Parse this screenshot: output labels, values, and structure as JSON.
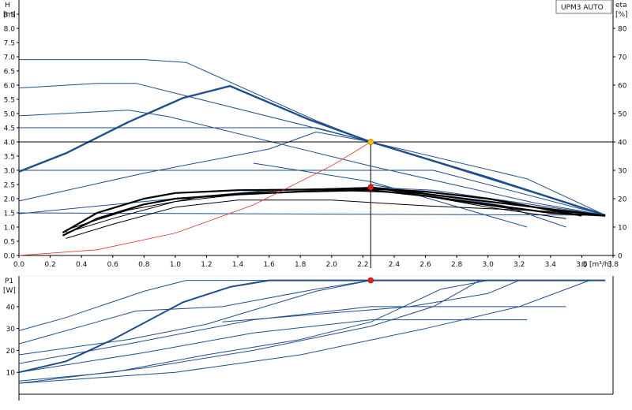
{
  "chart_data": [
    {
      "type": "line",
      "ylabel": "H",
      "ylabel_unit": "[m]",
      "y2label": "eta",
      "y2label_unit": "[%]",
      "xlabel": "Q [m³/h]",
      "model_label": "UPM3 AUTO",
      "xlim": [
        0,
        3.8
      ],
      "ylim": [
        0,
        9.0
      ],
      "y2lim": [
        0,
        90
      ],
      "xticks": [
        0.0,
        0.2,
        0.4,
        0.6,
        0.8,
        1.0,
        1.2,
        1.4,
        1.6,
        1.8,
        2.0,
        2.2,
        2.4,
        2.6,
        2.8,
        3.0,
        3.2,
        3.4,
        3.6,
        3.8
      ],
      "yticks": [
        0.0,
        0.5,
        1.0,
        1.5,
        2.0,
        2.5,
        3.0,
        3.5,
        4.0,
        4.5,
        5.0,
        5.5,
        6.0,
        6.5,
        7.0,
        7.5,
        8.0,
        8.5
      ],
      "y2ticks": [
        0,
        10,
        20,
        30,
        40,
        50,
        60,
        70,
        80
      ],
      "grid": "none",
      "colors": {
        "pump": "#1f4e8c",
        "system": "#e03030",
        "efficiency": "#000000",
        "marker_duty": "#f2c200",
        "marker_eff": "#e02020",
        "crosshair": "#000000"
      },
      "pump_curves": [
        {
          "points": [
            [
              0,
              2.95
            ],
            [
              0.3,
              3.6
            ],
            [
              0.7,
              4.7
            ],
            [
              1.05,
              5.55
            ],
            [
              1.35,
              5.97
            ],
            [
              1.85,
              4.8
            ],
            [
              2.25,
              4.0
            ],
            [
              3.0,
              2.75
            ],
            [
              3.75,
              1.42
            ]
          ],
          "bold": true
        },
        {
          "points": [
            [
              0,
              6.9
            ],
            [
              0.8,
              6.9
            ],
            [
              1.07,
              6.8
            ],
            [
              1.9,
              4.75
            ],
            [
              2.25,
              4.0
            ],
            [
              3.75,
              1.42
            ]
          ],
          "bold": false
        },
        {
          "points": [
            [
              0,
              5.9
            ],
            [
              0.5,
              6.06
            ],
            [
              0.75,
              6.06
            ],
            [
              2.25,
              4.0
            ],
            [
              3.25,
              2.7
            ],
            [
              3.75,
              1.42
            ]
          ],
          "bold": false
        },
        {
          "points": [
            [
              0,
              4.92
            ],
            [
              0.7,
              5.12
            ],
            [
              0.95,
              4.9
            ],
            [
              2.25,
              3.15
            ],
            [
              3.3,
              1.85
            ],
            [
              3.75,
              1.42
            ]
          ],
          "bold": false
        },
        {
          "points": [
            [
              0,
              4.5
            ],
            [
              1.9,
              4.5
            ],
            [
              2.25,
              4.0
            ]
          ],
          "bold": false
        },
        {
          "points": [
            [
              0,
              3.0
            ],
            [
              2.25,
              3.0
            ],
            [
              2.65,
              3.0
            ],
            [
              3.75,
              1.42
            ]
          ],
          "bold": false
        },
        {
          "points": [
            [
              0,
              1.92
            ],
            [
              0.8,
              2.9
            ],
            [
              1.6,
              3.75
            ],
            [
              1.9,
              4.35
            ],
            [
              2.25,
              4.0
            ]
          ],
          "bold": false
        },
        {
          "points": [
            [
              0,
              1.47
            ],
            [
              0.8,
              1.9
            ],
            [
              1.6,
              2.3
            ],
            [
              2.25,
              2.4
            ],
            [
              2.65,
              2.3
            ],
            [
              3.75,
              1.42
            ]
          ],
          "bold": false
        },
        {
          "points": [
            [
              0,
              1.5
            ],
            [
              3.75,
              1.42
            ]
          ],
          "bold": false
        },
        {
          "points": [
            [
              2.25,
              2.5
            ],
            [
              3.1,
              1.75
            ],
            [
              3.5,
              1.0
            ]
          ],
          "bold": false
        },
        {
          "points": [
            [
              1.5,
              3.25
            ],
            [
              2.25,
              2.6
            ],
            [
              3.25,
              1.0
            ]
          ],
          "bold": false
        }
      ],
      "system_curve": {
        "points": [
          [
            0,
            0
          ],
          [
            0.5,
            0.2
          ],
          [
            1.0,
            0.79
          ],
          [
            1.5,
            1.78
          ],
          [
            2.0,
            3.16
          ],
          [
            2.25,
            4.0
          ]
        ]
      },
      "efficiency_curves": [
        {
          "points": [
            [
              0.28,
              8
            ],
            [
              0.5,
              15
            ],
            [
              0.8,
              20
            ],
            [
              1.0,
              22
            ],
            [
              1.4,
              23
            ],
            [
              1.8,
              23.2
            ],
            [
              2.25,
              23.5
            ],
            [
              2.6,
              22.5
            ],
            [
              3.0,
              20
            ],
            [
              3.4,
              16
            ],
            [
              3.6,
              14
            ]
          ],
          "bold": true
        },
        {
          "points": [
            [
              0.28,
              7
            ],
            [
              0.5,
              13
            ],
            [
              0.8,
              18
            ],
            [
              1.0,
              20
            ],
            [
              1.4,
              21.5
            ],
            [
              1.8,
              22.5
            ],
            [
              2.25,
              23
            ],
            [
              2.6,
              21
            ],
            [
              3.0,
              18
            ],
            [
              3.4,
              15
            ],
            [
              3.75,
              14
            ]
          ],
          "bold": true
        },
        {
          "points": [
            [
              0.3,
              6
            ],
            [
              0.6,
              11
            ],
            [
              1.0,
              17
            ],
            [
              1.4,
              19.5
            ],
            [
              2.0,
              19.5
            ],
            [
              2.6,
              17.5
            ],
            [
              3.0,
              16.5
            ],
            [
              3.6,
              15
            ]
          ],
          "bold": false
        },
        {
          "points": [
            [
              0.3,
              8
            ],
            [
              0.6,
              13
            ],
            [
              1.0,
              19
            ],
            [
              1.5,
              22
            ],
            [
              2.0,
              23
            ],
            [
              2.5,
              22
            ],
            [
              3.0,
              17
            ],
            [
              3.5,
              13
            ]
          ],
          "bold": false
        },
        {
          "points": [
            [
              0.3,
              9
            ],
            [
              0.7,
              16
            ],
            [
              1.2,
              21
            ],
            [
              1.7,
              23
            ],
            [
              2.25,
              24
            ],
            [
              2.7,
              20
            ],
            [
              3.2,
              16
            ]
          ],
          "bold": false
        },
        {
          "points": [
            [
              2.25,
              24
            ],
            [
              3.75,
              14
            ]
          ],
          "bold": true
        }
      ],
      "duty_point": {
        "x": 2.25,
        "y": 4.0
      },
      "efficiency_point": {
        "x": 2.25,
        "y": 2.4
      }
    },
    {
      "type": "line",
      "ylabel": "P1",
      "ylabel_unit": "[W]",
      "xlim": [
        0,
        3.8
      ],
      "ylim": [
        0,
        54
      ],
      "yticks": [
        10,
        20,
        30,
        40
      ],
      "grid": "none",
      "power_curves": [
        {
          "points": [
            [
              0,
              10
            ],
            [
              0.3,
              15
            ],
            [
              0.6,
              25
            ],
            [
              1.05,
              42
            ],
            [
              1.35,
              49
            ],
            [
              1.6,
              52
            ],
            [
              3.75,
              52
            ]
          ],
          "bold": true
        },
        {
          "points": [
            [
              0,
              29
            ],
            [
              0.3,
              35
            ],
            [
              0.8,
              47
            ],
            [
              1.07,
              52
            ],
            [
              3.75,
              52
            ]
          ],
          "bold": false
        },
        {
          "points": [
            [
              0,
              23
            ],
            [
              0.5,
              33
            ],
            [
              0.75,
              38
            ],
            [
              1.3,
              40
            ],
            [
              1.9,
              48
            ],
            [
              2.25,
              52
            ],
            [
              3.75,
              52
            ]
          ],
          "bold": false
        },
        {
          "points": [
            [
              0,
              18
            ],
            [
              0.7,
              25
            ],
            [
              1.2,
              32
            ],
            [
              1.9,
              47
            ],
            [
              2.25,
              52
            ]
          ],
          "bold": false
        },
        {
          "points": [
            [
              0,
              14
            ],
            [
              0.7,
              23
            ],
            [
              1.5,
              34
            ],
            [
              2.25,
              40
            ],
            [
              3.5,
              40
            ]
          ],
          "bold": false
        },
        {
          "points": [
            [
              0,
              10
            ],
            [
              0.8,
              19
            ],
            [
              1.5,
              28
            ],
            [
              2.25,
              34
            ],
            [
              3.25,
              34
            ]
          ],
          "bold": false
        },
        {
          "points": [
            [
              0,
              5
            ],
            [
              0.8,
              12
            ],
            [
              1.5,
              20
            ],
            [
              2.25,
              31
            ],
            [
              2.65,
              40
            ],
            [
              2.95,
              52
            ]
          ],
          "bold": false
        },
        {
          "points": [
            [
              0,
              6
            ],
            [
              0.6,
              10
            ],
            [
              1.2,
              18
            ],
            [
              1.8,
              25
            ],
            [
              2.25,
              33
            ],
            [
              2.7,
              48
            ],
            [
              3.0,
              52
            ]
          ],
          "bold": false
        },
        {
          "points": [
            [
              0,
              5
            ],
            [
              1.0,
              10
            ],
            [
              1.8,
              18
            ],
            [
              2.6,
              30
            ],
            [
              3.2,
              40
            ],
            [
              3.65,
              52
            ]
          ],
          "bold": false
        },
        {
          "points": [
            [
              1.3,
              33
            ],
            [
              2.5,
              40
            ],
            [
              3.0,
              46
            ],
            [
              3.2,
              52
            ]
          ],
          "bold": false
        }
      ],
      "operating_point": {
        "x": 2.25,
        "y": 52
      }
    }
  ]
}
